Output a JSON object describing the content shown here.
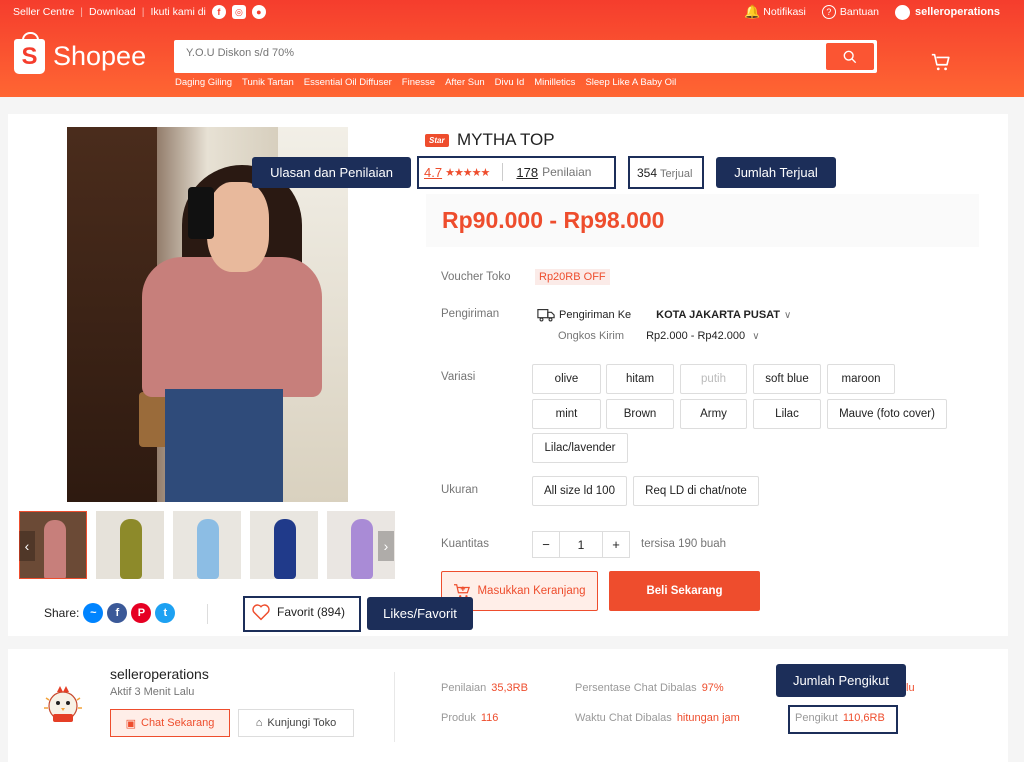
{
  "topbar": {
    "seller_centre": "Seller Centre",
    "download": "Download",
    "follow": "Ikuti kami di",
    "notif": "Notifikasi",
    "help": "Bantuan",
    "username": "selleroperations"
  },
  "header": {
    "logo": "Shopee",
    "search_placeholder": "Y.O.U Diskon s/d 70%",
    "keywords": [
      "Daging Giling",
      "Tunik Tartan",
      "Essential Oil Diffuser",
      "Finesse",
      "After Sun",
      "Divu Id",
      "Minilletics",
      "Sleep Like A Baby Oil"
    ]
  },
  "product": {
    "badge": "Star",
    "title": "MYTHA TOP",
    "rating": "4.7",
    "stars": "★★★★★",
    "review_count": "178",
    "review_label": "Penilaian",
    "sold_count": "354",
    "sold_label": "Terjual",
    "price": "Rp90.000 - Rp98.000",
    "voucher_label": "Voucher Toko",
    "voucher": "Rp20RB OFF",
    "shipping_label": "Pengiriman",
    "ship_to_label": "Pengiriman Ke",
    "ship_city": "KOTA JAKARTA PUSAT",
    "ship_cost_label": "Ongkos Kirim",
    "ship_cost": "Rp2.000 - Rp42.000",
    "variation_label": "Variasi",
    "variations": [
      "olive",
      "hitam",
      "putih",
      "soft blue",
      "maroon",
      "mint",
      "Brown",
      "Army",
      "Lilac",
      "Mauve (foto cover)",
      "Lilac/lavender"
    ],
    "size_label": "Ukuran",
    "sizes": [
      "All size ld 100",
      "Req LD di chat/note"
    ],
    "qty_label": "Kuantitas",
    "qty_minus": "−",
    "qty_value": "1",
    "qty_plus": "+",
    "stock": "tersisa 190 buah",
    "add_to_cart": "Masukkan Keranjang",
    "buy_now": "Beli Sekarang",
    "share_label": "Share:",
    "favorite": "Favorit (894)"
  },
  "annotations": {
    "reviews": "Ulasan dan Penilaian",
    "sold": "Jumlah Terjual",
    "likes": "Likes/Favorit",
    "followers": "Jumlah Pengikut",
    "hidden_tail": "lu"
  },
  "shop": {
    "name": "selleroperations",
    "active": "Aktif 3 Menit Lalu",
    "chat": "Chat Sekarang",
    "visit": "Kunjungi Toko",
    "ratings_label": "Penilaian",
    "ratings_value": "35,3RB",
    "products_label": "Produk",
    "products_value": "116",
    "chat_rate_label": "Persentase Chat Dibalas",
    "chat_rate_value": "97%",
    "chat_time_label": "Waktu Chat Dibalas",
    "chat_time_value": "hitungan jam",
    "followers_label": "Pengikut",
    "followers_value": "110,6RB"
  },
  "colors": {
    "brand": "#ee4d2d",
    "annotation": "#1c2e59"
  }
}
